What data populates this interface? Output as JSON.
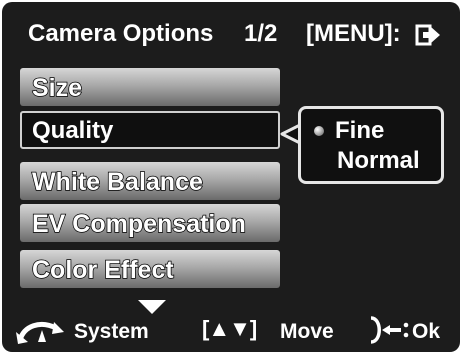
{
  "header": {
    "title": "Camera Options",
    "page": "1/2",
    "menu_label": "[MENU]:",
    "exit_icon": "exit-arrow-icon"
  },
  "menu": {
    "items": [
      {
        "label": "Size",
        "state": "inactive"
      },
      {
        "label": "Quality",
        "state": "selected"
      },
      {
        "label": "White Balance",
        "state": "inactive"
      },
      {
        "label": "EV Compensation",
        "state": "inactive"
      },
      {
        "label": "Color Effect",
        "state": "inactive"
      }
    ]
  },
  "popup": {
    "options": [
      {
        "label": "Fine",
        "selected": true
      },
      {
        "label": "Normal",
        "selected": false
      }
    ]
  },
  "footer": {
    "system_label": "System",
    "updown_label": "[▲▼]",
    "move_label": "Move",
    "ok_label": "Ok",
    "system_icon": "mode-dial-icon",
    "ok_icon": "shutter-button-icon"
  },
  "colors": {
    "background": "#1c1c1c",
    "text": "#ffffff",
    "selected_border": "#cfcfcf"
  }
}
